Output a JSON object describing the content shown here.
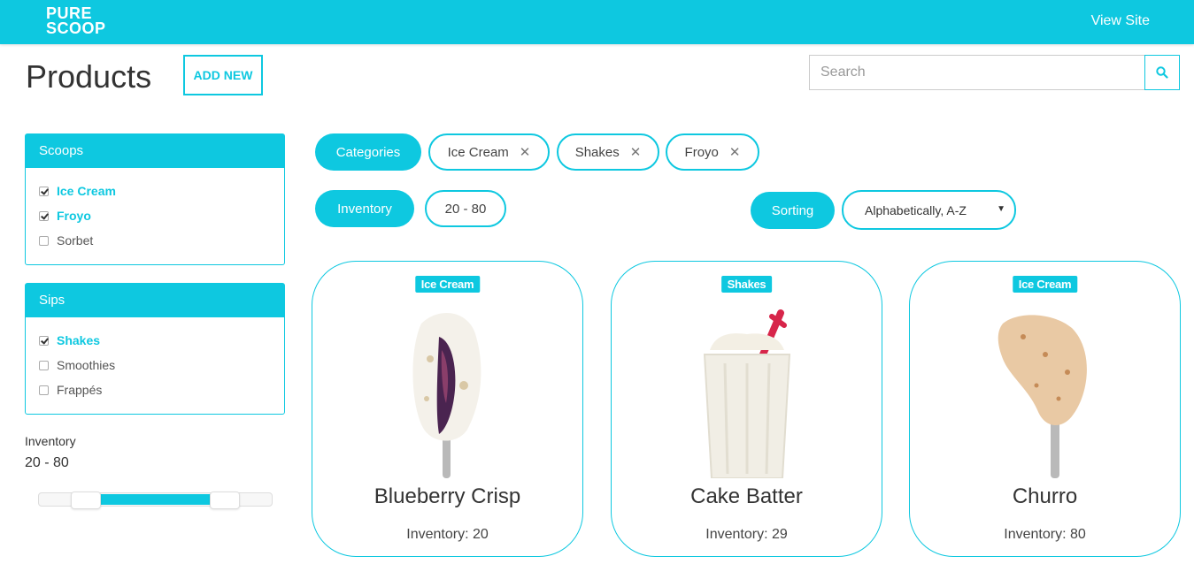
{
  "header": {
    "logo_line1": "PURE",
    "logo_line2": "SCOOP",
    "view_site": "View Site",
    "bg_color": "#0ec8e0"
  },
  "page": {
    "title": "Products",
    "add_new": "ADD NEW",
    "search_placeholder": "Search",
    "search_icon": "search-icon"
  },
  "sidebar": {
    "scoops": {
      "title": "Scoops",
      "items": [
        {
          "label": "Ice Cream",
          "checked": true
        },
        {
          "label": "Froyo",
          "checked": true
        },
        {
          "label": "Sorbet",
          "checked": false
        }
      ]
    },
    "sips": {
      "title": "Sips",
      "items": [
        {
          "label": "Shakes",
          "checked": true
        },
        {
          "label": "Smoothies",
          "checked": false
        },
        {
          "label": "Frappés",
          "checked": false
        }
      ]
    },
    "inventory": {
      "label": "Inventory",
      "range_text": "20 - 80",
      "slider_low_fraction": 0.2,
      "slider_high_fraction": 0.8
    }
  },
  "filters": {
    "categories_label": "Categories",
    "category_tags": [
      "Ice Cream",
      "Shakes",
      "Froyo"
    ],
    "inventory_label": "Inventory",
    "inventory_value": "20 - 80",
    "sorting_label": "Sorting",
    "sorting_value": "Alphabetically, A-Z"
  },
  "products": [
    {
      "badge": "Ice Cream",
      "name": "Blueberry Crisp",
      "inventory": "Inventory: 20"
    },
    {
      "badge": "Shakes",
      "name": "Cake Batter",
      "inventory": "Inventory: 29"
    },
    {
      "badge": "Ice Cream",
      "name": "Churro",
      "inventory": "Inventory: 80"
    }
  ]
}
